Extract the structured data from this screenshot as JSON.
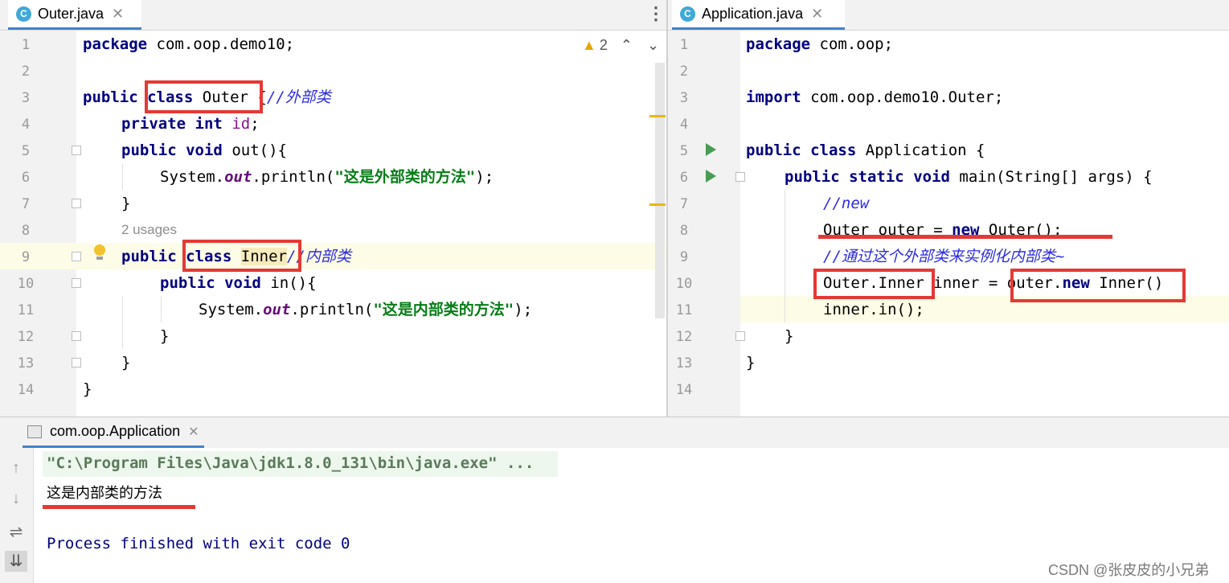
{
  "left_tab": {
    "icon": "java-class-icon",
    "label": "Outer.java"
  },
  "right_tab": {
    "icon": "java-class-icon",
    "label": "Application.java"
  },
  "left_editor": {
    "warnings": "2",
    "line_numbers": [
      "1",
      "2",
      "3",
      "4",
      "5",
      "6",
      "7",
      "8",
      "9",
      "10",
      "11",
      "12",
      "13",
      "14"
    ],
    "usages_hint": "2 usages",
    "lines": {
      "l1": {
        "kw": "package",
        "rest": " com.oop.demo10;"
      },
      "l3": {
        "kw1": "public",
        "kw2": "class",
        "name": "Outer",
        "brace": "{",
        "comment": "//外部类"
      },
      "l4": {
        "kw1": "private",
        "kw2": "int",
        "field": "id",
        "end": ";"
      },
      "l5": {
        "kw1": "public",
        "kw2": "void",
        "rest": "out(){"
      },
      "l6": {
        "pre": "System.",
        "field": "out",
        "mid": ".println(",
        "str": "\"这是外部类的方法\"",
        "end": ");"
      },
      "l7": {
        "text": "}"
      },
      "l8": {
        "kw1": "public",
        "kw2": "class",
        "name": "Inner",
        "comment": "//内部类"
      },
      "l9": {
        "kw1": "public",
        "kw2": "void",
        "rest": "in(){"
      },
      "l10": {
        "pre": "System.",
        "field": "out",
        "mid": ".println(",
        "str": "\"这是内部类的方法\"",
        "end": ");"
      },
      "l11": {
        "text": "}"
      },
      "l12": {
        "text": "}"
      },
      "l13": {
        "text": "}"
      }
    }
  },
  "right_editor": {
    "line_numbers": [
      "1",
      "2",
      "3",
      "4",
      "5",
      "6",
      "7",
      "8",
      "9",
      "10",
      "11",
      "12",
      "13",
      "14"
    ],
    "lines": {
      "l1": {
        "kw": "package",
        "rest": " com.oop;"
      },
      "l3": {
        "kw": "import",
        "rest": " com.oop.demo10.Outer;"
      },
      "l5": {
        "kw1": "public",
        "kw2": "class",
        "rest": "Application {"
      },
      "l6": {
        "kw1": "public",
        "kw2": "static",
        "kw3": "void",
        "rest": "main(String[] args) {"
      },
      "l7": {
        "comment": "//new"
      },
      "l8": {
        "pre": "Outer outer = ",
        "kw": "new",
        "rest": " Outer();"
      },
      "l9": {
        "comment": "//通过这个外部类来实例化内部类~"
      },
      "l10": {
        "type": "Outer.Inner",
        "mid": " inner = ",
        "pre2": "outer.",
        "kw": "new",
        "rest": " Inner()"
      },
      "l11": {
        "text": "inner.in();"
      },
      "l12": {
        "text": "}"
      },
      "l13": {
        "text": "}"
      }
    }
  },
  "console": {
    "tab_label": "com.oop.Application",
    "command": "\"C:\\Program Files\\Java\\jdk1.8.0_131\\bin\\java.exe\" ...",
    "output": "这是内部类的方法",
    "exit": "Process finished with exit code 0"
  },
  "watermark": "CSDN @张皮皮的小兄弟",
  "colors": {
    "keyword": "#000080",
    "string": "#067d17",
    "comment": "#2c2ce0",
    "highlight": "#e53935"
  }
}
